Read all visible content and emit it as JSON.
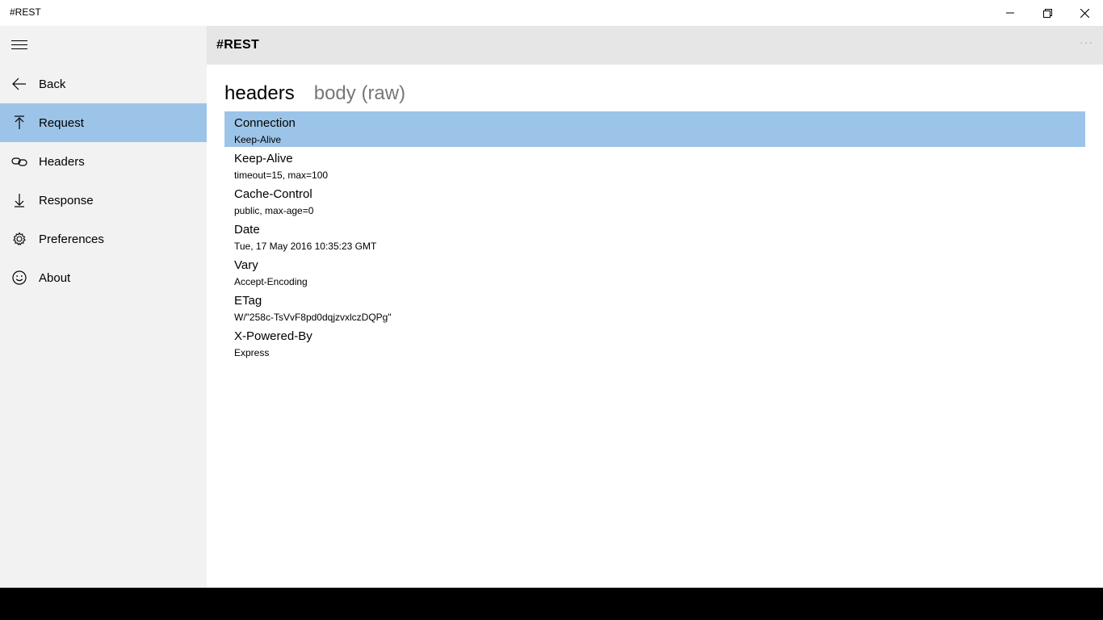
{
  "window": {
    "title": "#REST"
  },
  "sidebar": {
    "items": [
      {
        "label": "Back",
        "icon": "back-arrow-icon"
      },
      {
        "label": "Request",
        "icon": "upload-arrow-icon",
        "active": true
      },
      {
        "label": "Headers",
        "icon": "link-icon"
      },
      {
        "label": "Response",
        "icon": "download-arrow-icon"
      },
      {
        "label": "Preferences",
        "icon": "gear-icon"
      },
      {
        "label": "About",
        "icon": "smiley-icon"
      }
    ]
  },
  "header": {
    "title": "#REST",
    "more": "···"
  },
  "tabs": [
    {
      "label": "headers",
      "active": true
    },
    {
      "label": "body (raw)",
      "active": false
    }
  ],
  "headers": [
    {
      "name": "Connection",
      "value": "Keep-Alive"
    },
    {
      "name": "Keep-Alive",
      "value": "timeout=15, max=100"
    },
    {
      "name": "Cache-Control",
      "value": "public, max-age=0"
    },
    {
      "name": "Date",
      "value": "Tue, 17 May 2016 10:35:23 GMT"
    },
    {
      "name": "Vary",
      "value": "Accept-Encoding"
    },
    {
      "name": "ETag",
      "value": "W/\"258c-TsVvF8pd0dqjzvxlczDQPg\""
    },
    {
      "name": "X-Powered-By",
      "value": "Express"
    }
  ],
  "colors": {
    "accent": "#9cc4e8",
    "sidebar_bg": "#f2f2f2",
    "header_bg": "#e6e6e6"
  }
}
